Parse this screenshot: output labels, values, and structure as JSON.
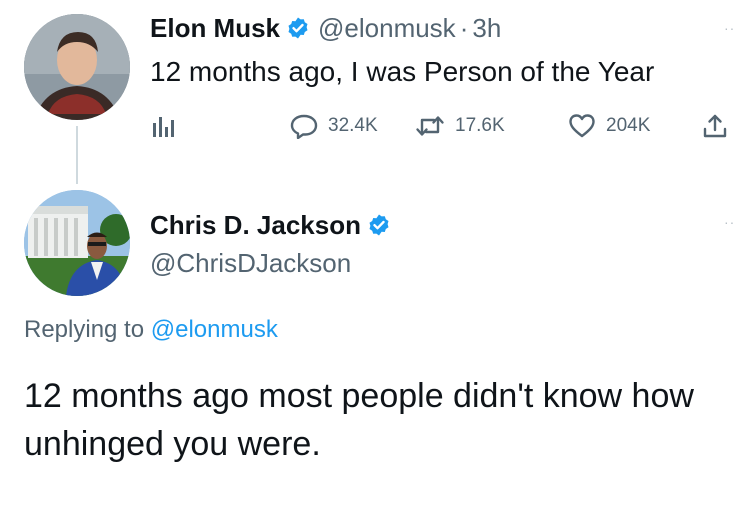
{
  "tweet1": {
    "name": "Elon Musk",
    "handle": "@elonmusk",
    "separator": "·",
    "time": "3h",
    "text": "12 months ago, I was Person of the Year",
    "more": "··",
    "actions": {
      "replies": "32.4K",
      "retweets": "17.6K",
      "likes": "204K"
    }
  },
  "tweet2": {
    "name": "Chris D. Jackson",
    "handle": "@ChrisDJackson",
    "more": "··",
    "replying_prefix": "Replying to ",
    "replying_to": "@elonmusk",
    "text": "12 months ago most people didn't know how unhinged you were."
  },
  "icons": {
    "verified": "verified-badge-icon",
    "analytics": "analytics-icon",
    "reply": "reply-icon",
    "retweet": "retweet-icon",
    "like": "heart-icon",
    "share": "share-icon"
  },
  "colors": {
    "accent": "#1d9bf0",
    "secondary_text": "#536471",
    "primary_text": "#0f1419"
  }
}
